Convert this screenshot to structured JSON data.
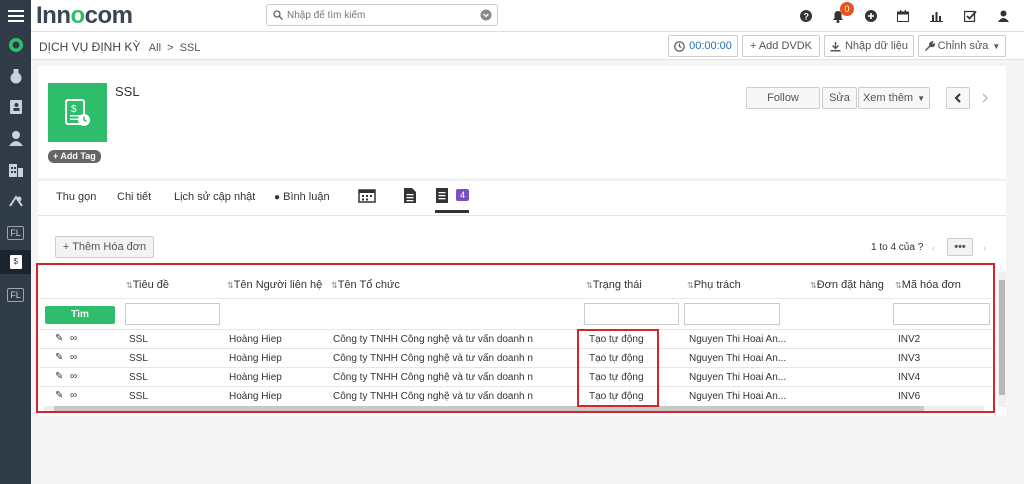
{
  "app": {
    "logo_prefix": "Inn",
    "logo_o": "o",
    "logo_suffix": "com"
  },
  "search": {
    "placeholder": "Nhập để tìm kiếm"
  },
  "notifications": {
    "count": "0"
  },
  "breadcrumb": {
    "main": "DỊCH VỤ ĐỊNH KỲ",
    "level1": "All",
    "level2": "SSL",
    "separator": ">"
  },
  "toolbar": {
    "timer": "00:00:00",
    "add_label": "+ Add DVDK",
    "import_label": "Nhập dữ liệu",
    "edit_label": "Chỉnh sửa"
  },
  "record": {
    "title": "SSL",
    "add_tag": "+ Add Tag",
    "follow": "Follow",
    "edit": "Sửa",
    "more": "Xem thêm"
  },
  "tabs": {
    "summary": "Thu gọn",
    "detail": "Chi tiết",
    "history": "Lịch sử cập nhật",
    "comments": "Bình luận",
    "invoice_count": "4"
  },
  "invoices": {
    "add_label": "+ Thêm Hóa đơn",
    "pager": "1 to 4  của ?",
    "search_button": "Tìm",
    "columns": {
      "title": "Tiêu đề",
      "contact": "Tên Người liên hệ",
      "org": "Tên Tổ chức",
      "status": "Trạng thái",
      "owner": "Phụ trách",
      "order": "Đơn đặt hàng",
      "code": "Mã hóa đơn"
    },
    "rows": [
      {
        "title": "SSL",
        "contact": "Hoàng Hiep",
        "org": "Công ty TNHH Công nghệ và tư vấn doanh n...",
        "status": "Tạo tự động",
        "owner": "Nguyen Thi Hoai An...",
        "order": "",
        "code": "INV2"
      },
      {
        "title": "SSL",
        "contact": "Hoàng Hiep",
        "org": "Công ty TNHH Công nghệ và tư vấn doanh n...",
        "status": "Tạo tự động",
        "owner": "Nguyen Thi Hoai An...",
        "order": "",
        "code": "INV3"
      },
      {
        "title": "SSL",
        "contact": "Hoàng Hiep",
        "org": "Công ty TNHH Công nghệ và tư vấn doanh n...",
        "status": "Tạo tự động",
        "owner": "Nguyen Thi Hoai An...",
        "order": "",
        "code": "INV4"
      },
      {
        "title": "SSL",
        "contact": "Hoàng Hiep",
        "org": "Công ty TNHH Công nghệ và tư vấn doanh n...",
        "status": "Tạo tự động",
        "owner": "Nguyen Thi Hoai An...",
        "order": "",
        "code": "INV6"
      }
    ]
  },
  "sidebar": {
    "fl1": "FL",
    "fl2": "FL"
  },
  "colors": {
    "accent": "#2ebd6b",
    "highlight": "#d6242c",
    "badge": "#e8521b",
    "tabcount": "#7b4fc2"
  }
}
